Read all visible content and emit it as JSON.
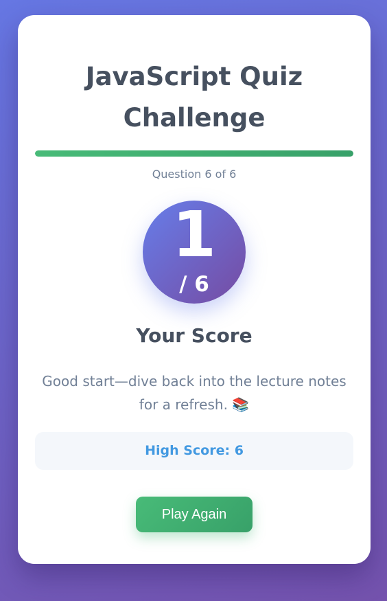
{
  "quiz": {
    "title": "JavaScript Quiz Challenge",
    "question_counter": "Question 6 of 6",
    "progress_fraction": 1.0
  },
  "score": {
    "value": "1",
    "total": "/ 6",
    "label": "Your Score"
  },
  "feedback": {
    "text": "Good start—dive back into the lecture notes for a refresh. 📚"
  },
  "high_score": {
    "text": "High Score: 6"
  },
  "actions": {
    "play_again_label": "Play Again"
  },
  "colors": {
    "background_start": "#6677e3",
    "background_end": "#7452ad",
    "progress": "#48bb78",
    "score_circle_start": "#667eea",
    "score_circle_end": "#764ba2",
    "high_score_text": "#4299e1",
    "button": "#48bb78"
  }
}
